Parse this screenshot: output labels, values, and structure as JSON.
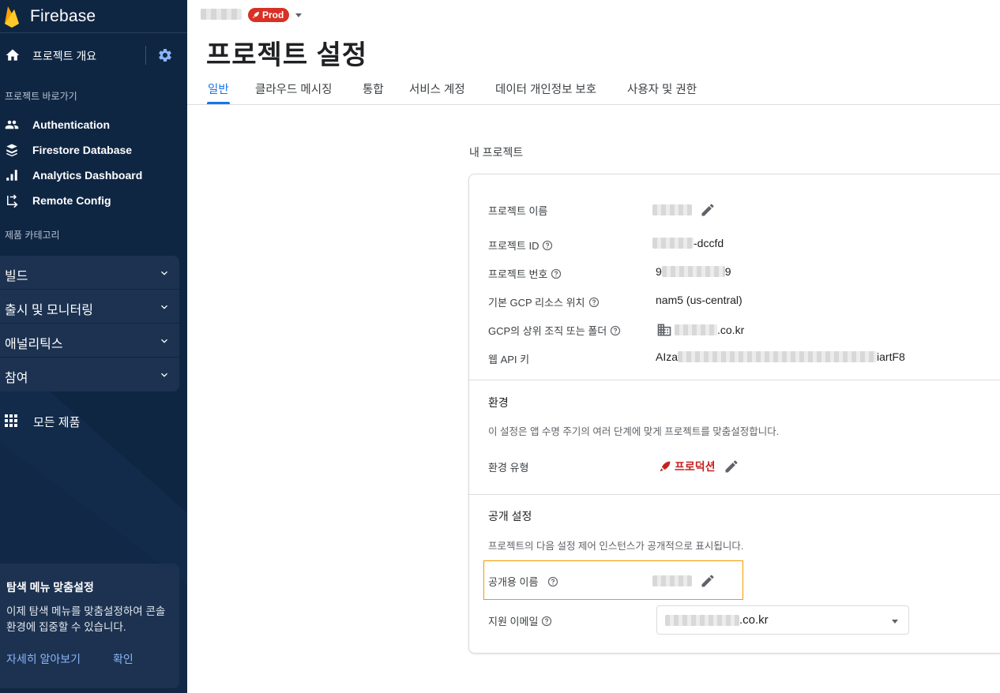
{
  "brand": {
    "name": "Firebase"
  },
  "nav": {
    "overview_label": "프로젝트 개요",
    "shortcuts_label": "프로젝트 바로가기",
    "shortcuts": [
      {
        "label": "Authentication",
        "icon": "people-icon"
      },
      {
        "label": "Firestore Database",
        "icon": "firestore-icon"
      },
      {
        "label": "Analytics Dashboard",
        "icon": "bar-chart-icon"
      },
      {
        "label": "Remote Config",
        "icon": "remote-config-icon"
      }
    ],
    "categories_label": "제품 카테고리",
    "categories": [
      {
        "label": "빌드"
      },
      {
        "label": "출시 및 모니터링"
      },
      {
        "label": "애널리틱스"
      },
      {
        "label": "참여"
      }
    ],
    "all_products_label": "모든 제품"
  },
  "promo": {
    "title": "탐색 메뉴 맞춤설정",
    "desc": "이제 탐색 메뉴를 맞춤설정하여 콘솔 환경에 집중할 수 있습니다.",
    "learn_more": "자세히 알아보기",
    "confirm": "확인"
  },
  "header": {
    "prod_badge": "Prod",
    "page_title": "프로젝트 설정"
  },
  "tabs": [
    {
      "label": "일반",
      "active": true
    },
    {
      "label": "클라우드 메시징",
      "active": false
    },
    {
      "label": "통합",
      "active": false
    },
    {
      "label": "서비스 계정",
      "active": false
    },
    {
      "label": "데이터 개인정보 보호",
      "active": false
    },
    {
      "label": "사용자 및 권한",
      "active": false
    }
  ],
  "my_project": {
    "section_label": "내 프로젝트",
    "rows": {
      "name_label": "프로젝트 이름",
      "id_label": "프로젝트 ID",
      "id_suffix": "-dccfd",
      "number_label": "프로젝트 번호",
      "number_prefix": "9",
      "number_suffix": "9",
      "gcp_location_label": "기본 GCP 리소스 위치",
      "gcp_location_value": "nam5 (us-central)",
      "parent_label": "GCP의 상위 조직 또는 폴더",
      "parent_suffix": ".co.kr",
      "api_key_label": "웹 API 키",
      "api_key_prefix": "AIza",
      "api_key_suffix": "iartF8"
    }
  },
  "environment": {
    "title": "환경",
    "desc": "이 설정은 앱 수명 주기의 여러 단계에 맞게 프로젝트를 맞춤설정합니다.",
    "type_label": "환경 유형",
    "type_value": "프로덕션"
  },
  "public_settings": {
    "title": "공개 설정",
    "desc": "프로젝트의 다음 설정 제어 인스턴스가 공개적으로 표시됩니다.",
    "public_name_label": "공개용 이름",
    "support_email_label": "지원 이메일",
    "support_email_suffix": ".co.kr"
  },
  "colors": {
    "sidebar_bg": "#0f2643",
    "accent": "#1a73e8",
    "prod_red": "#d93025",
    "highlight": "#f29900"
  }
}
